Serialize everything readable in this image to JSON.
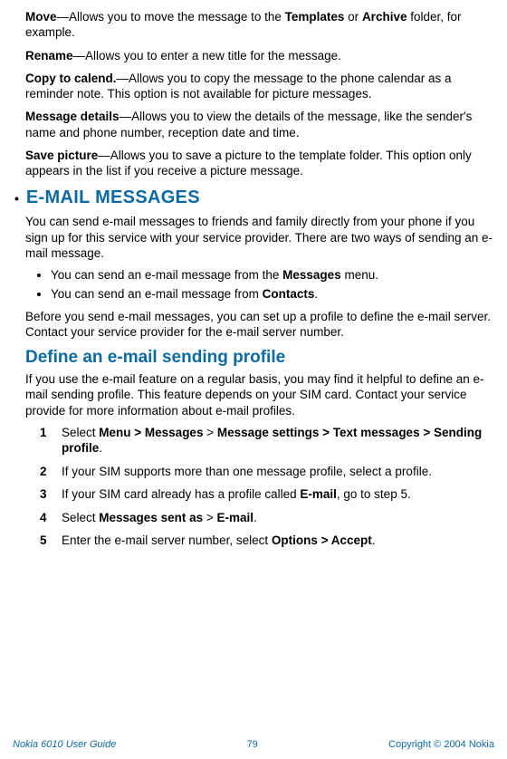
{
  "definitions": {
    "move": {
      "term": "Move",
      "text": "—Allows you to move the message to the ",
      "folder1": "Templates",
      "or": " or ",
      "folder2": "Archive",
      "rest": " folder, for example."
    },
    "rename": {
      "term": "Rename",
      "text": "—Allows you to enter a new title for the message."
    },
    "copy": {
      "term": "Copy to calend.",
      "text": "—Allows you to copy the message to the phone calendar as a reminder note. This option is not available for picture messages."
    },
    "details": {
      "term": "Message details",
      "text": "—Allows you to view the details of the message, like the sender's name and phone number, reception date and time."
    },
    "save": {
      "term": "Save picture",
      "text": "—Allows you to save a picture to the template folder. This option only appears in the list if you receive a picture message."
    }
  },
  "section": {
    "heading": "E-MAIL MESSAGES",
    "intro": "You can send e-mail messages to friends and family directly from your phone if you sign up for this service with your service provider. There are two ways of sending an e-mail message.",
    "bullet1_a": "You can send an e-mail message from the ",
    "bullet1_b": "Messages",
    "bullet1_c": " menu.",
    "bullet2_a": "You can send an e-mail message from ",
    "bullet2_b": "Contacts",
    "bullet2_c": ".",
    "after_bullets": "Before you send e-mail messages, you can set up a profile to define the e-mail server. Contact your service provider for the e-mail server number."
  },
  "profile": {
    "heading": "Define an e-mail sending profile",
    "intro": "If you use the e-mail feature on a regular basis, you may find it helpful to define an e-mail sending profile. This feature depends on your SIM card. Contact your service provide for more information about e-mail profiles.",
    "step1_a": "Select ",
    "step1_b": "Menu > Messages",
    "step1_c": " > ",
    "step1_d": "Message settings > Text messages > Sending profile",
    "step1_e": ".",
    "step2": "If your SIM supports more than one message profile, select a profile.",
    "step3_a": "If your SIM card already has a profile called ",
    "step3_b": "E-mail",
    "step3_c": ", go to step 5.",
    "step4_a": "Select ",
    "step4_b": "Messages sent as",
    "step4_c": " > ",
    "step4_d": "E-mail",
    "step4_e": ".",
    "step5_a": "Enter the e-mail server number, select ",
    "step5_b": "Options > Accept",
    "step5_c": "."
  },
  "footer": {
    "left": "Nokia 6010 User Guide",
    "center": "79",
    "right": "Copyright © 2004 Nokia"
  }
}
